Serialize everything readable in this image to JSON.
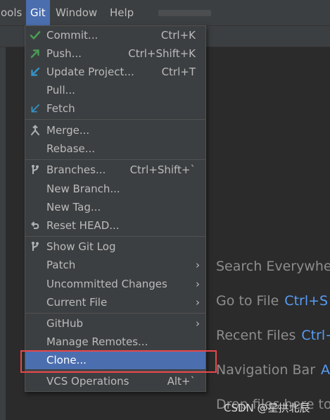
{
  "menubar": {
    "items": [
      "ools",
      "Git",
      "Window",
      "Help"
    ]
  },
  "welcome_hints": [
    {
      "label": "Search Everywhe",
      "key": ""
    },
    {
      "label": "Go to File",
      "key": "Ctrl+S"
    },
    {
      "label": "Recent Files",
      "key": "Ctrl+"
    },
    {
      "label": "Navigation Bar",
      "key": "A"
    },
    {
      "label": "Drop files here to",
      "key": ""
    }
  ],
  "watermark": "CSDN @星拱北辰",
  "git_menu": {
    "items": [
      {
        "label": "Commit...",
        "shortcut": "Ctrl+K",
        "icon": "check-icon",
        "icon_color": "#499c54"
      },
      {
        "label": "Push...",
        "shortcut": "Ctrl+Shift+K",
        "icon": "push-arrow-icon",
        "icon_color": "#499c54"
      },
      {
        "label": "Update Project...",
        "shortcut": "Ctrl+T",
        "icon": "update-arrow-icon",
        "icon_color": "#3592c4"
      },
      {
        "label": "Pull...",
        "shortcut": ""
      },
      {
        "label": "Fetch",
        "shortcut": "",
        "icon": "fetch-arrow-icon",
        "icon_color": "#3592c4"
      },
      {
        "label": "Merge...",
        "shortcut": "",
        "icon": "merge-icon",
        "icon_color": "#afb1b3"
      },
      {
        "label": "Rebase...",
        "shortcut": ""
      },
      {
        "label": "Branches...",
        "shortcut": "Ctrl+Shift+`",
        "icon": "branch-icon",
        "icon_color": "#afb1b3"
      },
      {
        "label": "New Branch...",
        "shortcut": ""
      },
      {
        "label": "New Tag...",
        "shortcut": ""
      },
      {
        "label": "Reset HEAD...",
        "shortcut": "",
        "icon": "undo-icon",
        "icon_color": "#afb1b3"
      },
      {
        "label": "Show Git Log",
        "shortcut": "",
        "icon": "branch-icon",
        "icon_color": "#afb1b3"
      },
      {
        "label": "Patch",
        "shortcut": "",
        "submenu": true
      },
      {
        "label": "Uncommitted Changes",
        "shortcut": "",
        "submenu": true
      },
      {
        "label": "Current File",
        "shortcut": "",
        "submenu": true
      },
      {
        "label": "GitHub",
        "shortcut": "",
        "submenu": true
      },
      {
        "label": "Manage Remotes...",
        "shortcut": ""
      },
      {
        "label": "Clone...",
        "shortcut": "",
        "highlighted": true
      },
      {
        "label": "VCS Operations",
        "shortcut": "Alt+`"
      }
    ]
  },
  "colors": {
    "menu_bg": "#3c3f41",
    "highlight": "#4b6eaf",
    "annotation_box": "#e8474a",
    "editor_bg": "#2b2b2b",
    "shortcut_hint": "#589df6"
  }
}
